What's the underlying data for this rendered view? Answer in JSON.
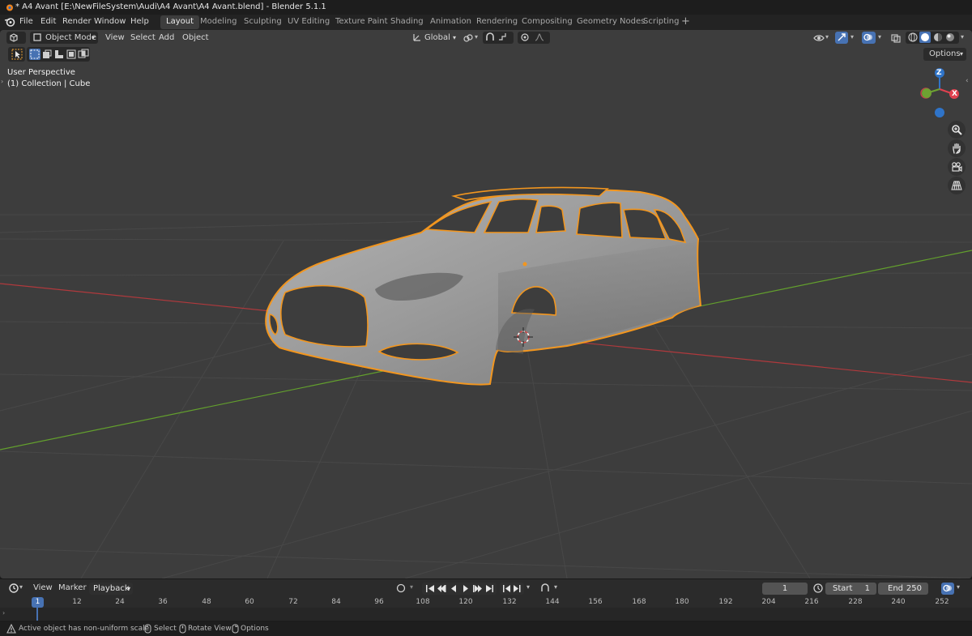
{
  "window": {
    "title": "* A4 Avant [E:\\NewFileSystem\\Audi\\A4 Avant\\A4 Avant.blend] - Blender 5.1.1"
  },
  "menu": {
    "file": "File",
    "edit": "Edit",
    "render": "Render",
    "window": "Window",
    "help": "Help"
  },
  "workspaces": [
    {
      "label": "Layout",
      "active": true
    },
    {
      "label": "Modeling"
    },
    {
      "label": "Sculpting"
    },
    {
      "label": "UV Editing"
    },
    {
      "label": "Texture Paint"
    },
    {
      "label": "Shading"
    },
    {
      "label": "Animation"
    },
    {
      "label": "Rendering"
    },
    {
      "label": "Compositing"
    },
    {
      "label": "Geometry Nodes"
    },
    {
      "label": "Scripting"
    }
  ],
  "viewport_header": {
    "mode": "Object Mode",
    "view": "View",
    "select": "Select",
    "add": "Add",
    "object": "Object",
    "transform_orientation": "Global",
    "options": "Options"
  },
  "viewport": {
    "perspective_label": "User Perspective",
    "collection_label": "(1) Collection | Cube",
    "gizmo": {
      "z": "Z",
      "x": "X"
    },
    "colors": {
      "background": "#3d3d3d",
      "selection_outline": "#f2961f",
      "x_axis": "#b0393d",
      "y_axis": "#63a02d",
      "z_gizmo": "#2f74c9",
      "x_gizmo": "#e0414f",
      "y_gizmo": "#6ea232"
    }
  },
  "timeline": {
    "view": "View",
    "marker": "Marker",
    "playback": "Playback",
    "current_frame": "1",
    "start_label": "Start",
    "start_value": "1",
    "end_label": "End",
    "end_value": "250",
    "ruler_ticks": [
      "1",
      "12",
      "24",
      "36",
      "48",
      "60",
      "72",
      "84",
      "96",
      "108",
      "120",
      "132",
      "144",
      "156",
      "168",
      "180",
      "192",
      "204",
      "216",
      "228",
      "240",
      "252"
    ]
  },
  "statusbar": {
    "warning": "Active object has non-uniform scale",
    "select": "Select",
    "rotate": "Rotate View",
    "options": "Options"
  }
}
